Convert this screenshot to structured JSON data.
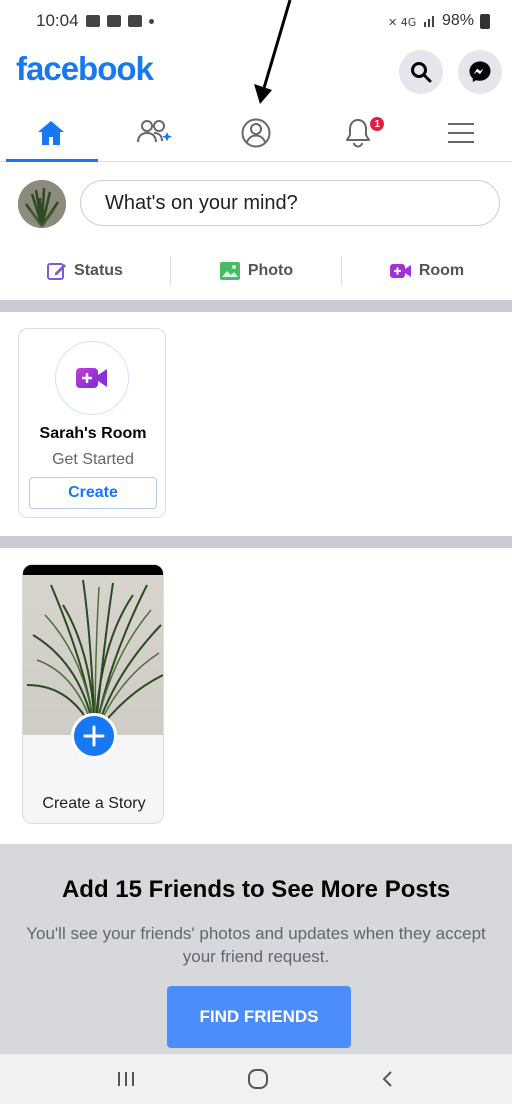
{
  "status_bar": {
    "time": "10:04",
    "battery": "98%"
  },
  "header": {
    "logo": "facebook"
  },
  "tabs": [
    {
      "name": "home-icon"
    },
    {
      "name": "friends-icon"
    },
    {
      "name": "profile-icon"
    },
    {
      "name": "notifications-icon",
      "badge": "1"
    },
    {
      "name": "menu-icon"
    }
  ],
  "composer": {
    "placeholder": "What's on your mind?"
  },
  "actions": {
    "status": "Status",
    "photo": "Photo",
    "room": "Room"
  },
  "room_card": {
    "title": "Sarah's Room",
    "subtitle": "Get Started",
    "button": "Create"
  },
  "story_card": {
    "label": "Create a Story"
  },
  "promo": {
    "title": "Add 15 Friends to See More Posts",
    "text": "You'll see your friends' photos and updates when they accept your friend request.",
    "button": "FIND FRIENDS"
  },
  "colors": {
    "brand": "#1877f2",
    "badge": "#e41e3f",
    "room": "#a032d6",
    "photo": "#45bd62"
  }
}
